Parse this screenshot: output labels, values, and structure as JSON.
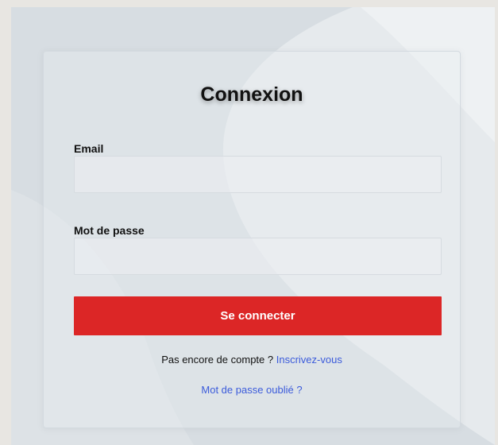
{
  "login": {
    "title": "Connexion",
    "email_label": "Email",
    "email_value": "",
    "password_label": "Mot de passe",
    "password_value": "",
    "submit_label": "Se connecter",
    "no_account_text": "Pas encore de compte ?",
    "signup_link": "Inscrivez-vous",
    "forgot_link": "Mot de passe oublié ?"
  },
  "colors": {
    "primary_button": "#dc2626",
    "link": "#3b5bdb",
    "background": "#e4e8eb"
  }
}
